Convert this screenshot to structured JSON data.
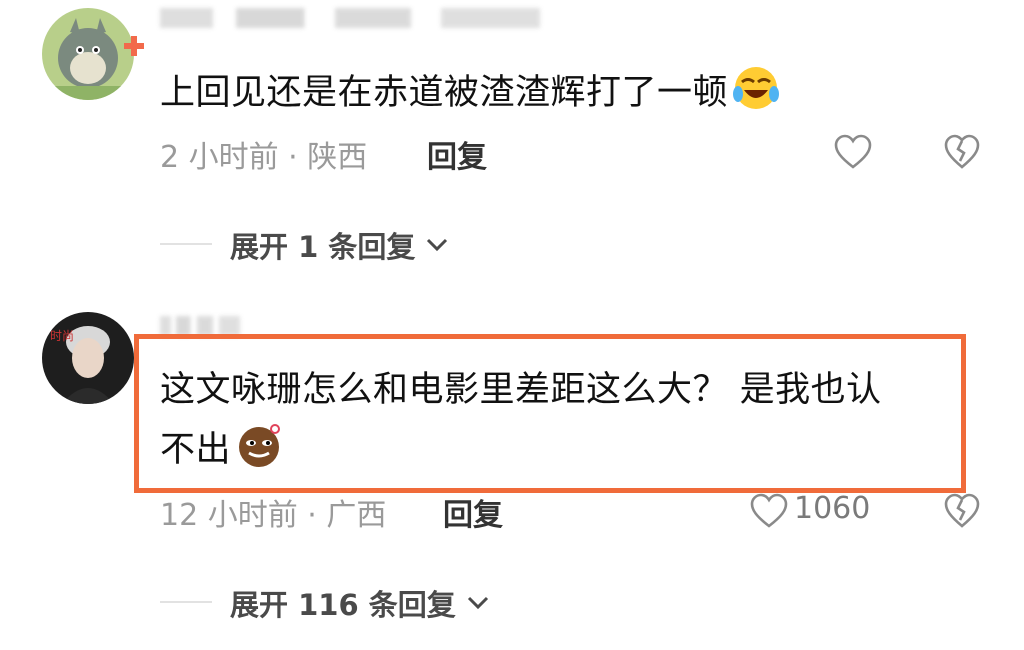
{
  "comments": [
    {
      "text": "上回见还是在赤道被渣渣辉打了一顿",
      "emoji": "laughing-tears-emoji",
      "time": "2 小时前",
      "location": "陕西",
      "reply": "回复",
      "like_count": "",
      "expand": "展开 1 条回复"
    },
    {
      "text_line1": "这文咏珊怎么和电影里差距这么大？ 是我也认",
      "text_line2": "不出",
      "emoji": "smug-face-emoji",
      "time": "12 小时前",
      "location": "广西",
      "reply": "回复",
      "like_count": "1060",
      "expand": "展开 116 条回复"
    }
  ],
  "meta_sep": "·",
  "highlight_color": "#f06b3a"
}
